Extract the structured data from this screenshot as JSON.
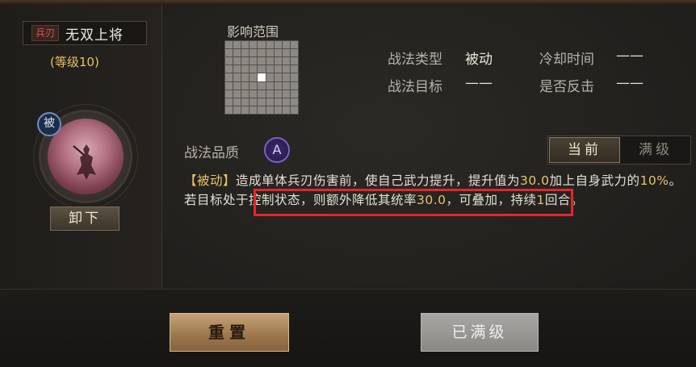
{
  "skill": {
    "type_tag": "兵刃",
    "name": "无双上将",
    "level": "(等级10)",
    "passive_badge": "被",
    "unequip_label": "卸下"
  },
  "range": {
    "title": "影响范围",
    "grid_size": 9,
    "center_index": 40
  },
  "info": {
    "type_label": "战法类型",
    "type_value": "被动",
    "cooldown_label": "冷却时间",
    "cooldown_value": "——",
    "target_label": "战法目标",
    "target_value": "——",
    "counter_label": "是否反击",
    "counter_value": "——"
  },
  "quality": {
    "label": "战法品质",
    "grade": "A"
  },
  "tabs": {
    "current": "当前",
    "max": "满级"
  },
  "description": {
    "tag": "【被动】",
    "part1": "造成单体兵刃伤害前，使自己武力提升，提升值为",
    "num1": "30.0",
    "part2": "加上自身武力的",
    "num2": "10%",
    "part3": "。若目标处于控制状态，则额外降低其统率",
    "num3": "30.0",
    "part4": "，可叠加，持续",
    "num4": "1",
    "part5": "回合。"
  },
  "buttons": {
    "reset": "重置",
    "maxed": "已满级"
  },
  "colors": {
    "highlight_box": "#e3262b",
    "gold_text": "#e6c36b",
    "quality_purple": "#7c5fc7"
  }
}
